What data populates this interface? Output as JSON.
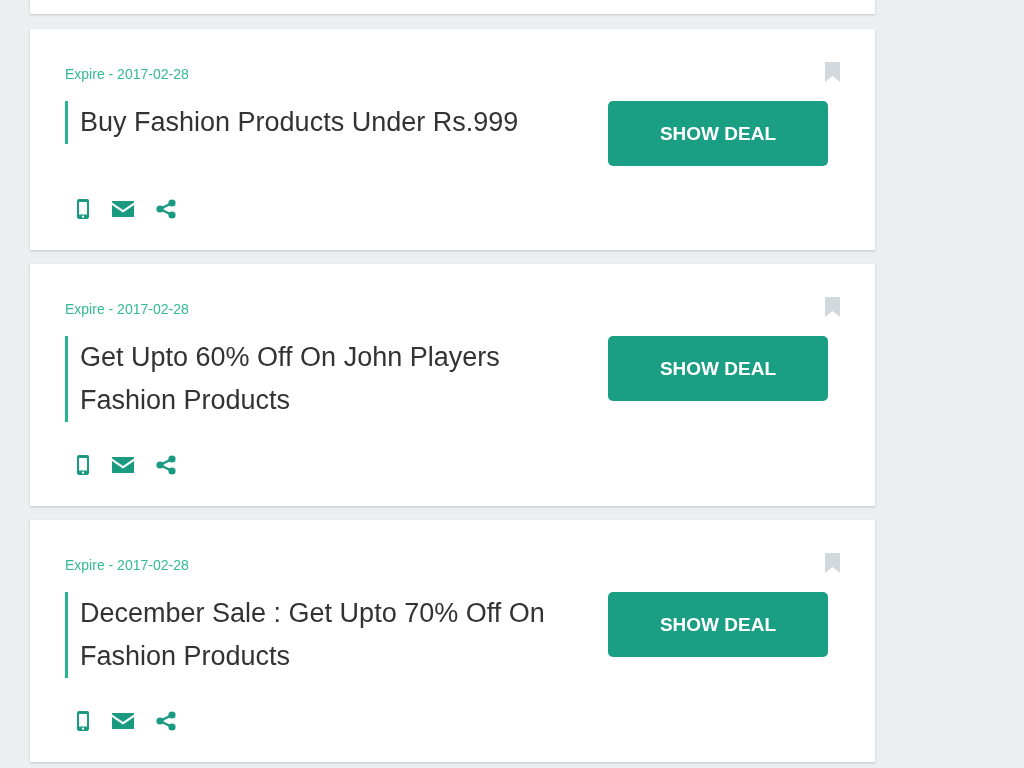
{
  "deals": [
    {
      "expiry": "Expire - 2017-02-28",
      "bookmarked": false,
      "title": "Buy Fashion Products Under Rs.999",
      "button": "SHOW DEAL"
    },
    {
      "expiry": "Expire - 2017-02-28",
      "bookmarked": false,
      "title": "Get Upto 60% Off On John Players Fashion Products",
      "button": "SHOW DEAL"
    },
    {
      "expiry": "Expire - 2017-02-28",
      "bookmarked": false,
      "title": "December Sale : Get Upto 70% Off On Fashion Products",
      "button": "SHOW DEAL"
    }
  ]
}
